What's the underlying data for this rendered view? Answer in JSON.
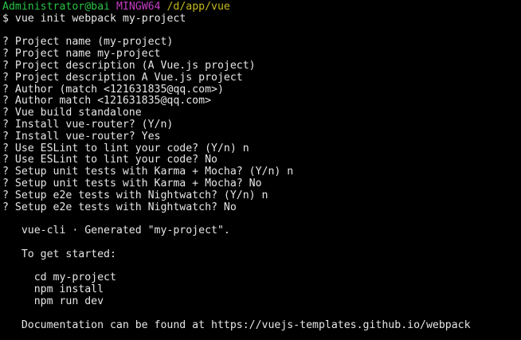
{
  "prompt": {
    "user": "Administrator@bai",
    "shell": "MINGW64",
    "path": "/d/app/vue",
    "symbol": "$",
    "command": "vue init webpack my-project"
  },
  "output_lines": [
    "",
    "? Project name (my-project)",
    "? Project name my-project",
    "? Project description (A Vue.js project)",
    "? Project description A Vue.js project",
    "? Author (match <121631835@qq.com>)",
    "? Author match <121631835@qq.com>",
    "? Vue build standalone",
    "? Install vue-router? (Y/n)",
    "? Install vue-router? Yes",
    "? Use ESLint to lint your code? (Y/n) n",
    "? Use ESLint to lint your code? No",
    "? Setup unit tests with Karma + Mocha? (Y/n) n",
    "? Setup unit tests with Karma + Mocha? No",
    "? Setup e2e tests with Nightwatch? (Y/n) n",
    "? Setup e2e tests with Nightwatch? No",
    "",
    "   vue-cli · Generated \"my-project\".",
    "",
    "   To get started:",
    "",
    "     cd my-project",
    "     npm install",
    "     npm run dev",
    "",
    "   Documentation can be found at https://vuejs-templates.github.io/webpack"
  ],
  "colors": {
    "background": "#000000",
    "text": "#e6e6e6",
    "user": "#29c446",
    "shell": "#c43cc4",
    "path": "#c4b81e"
  }
}
